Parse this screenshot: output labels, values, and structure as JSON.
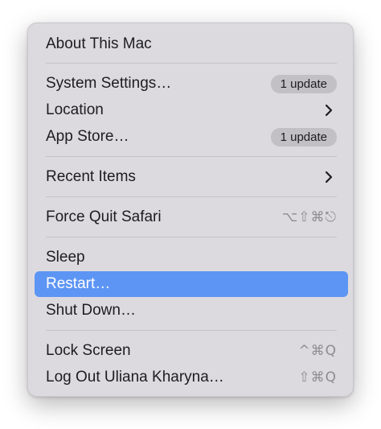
{
  "menu": {
    "about": {
      "label": "About This Mac"
    },
    "system_settings": {
      "label": "System Settings…",
      "badge": "1 update"
    },
    "location": {
      "label": "Location",
      "icon": "chevron-right-icon"
    },
    "app_store": {
      "label": "App Store…",
      "badge": "1 update"
    },
    "recent_items": {
      "label": "Recent Items",
      "icon": "chevron-right-icon"
    },
    "force_quit": {
      "label": "Force Quit Safari",
      "shortcut": "⌥⇧⌘⎋"
    },
    "sleep": {
      "label": "Sleep"
    },
    "restart": {
      "label": "Restart…",
      "highlighted": true
    },
    "shut_down": {
      "label": "Shut Down…"
    },
    "lock_screen": {
      "label": "Lock Screen",
      "shortcut": "^⌘Q"
    },
    "log_out": {
      "label": "Log Out Uliana Kharyna…",
      "shortcut": "⇧⌘Q"
    }
  },
  "colors": {
    "menu_background": "#dcdadf",
    "highlight": "#5d95f4",
    "badge_background": "#c2c0c5",
    "shortcut_text": "#8e8c92"
  }
}
